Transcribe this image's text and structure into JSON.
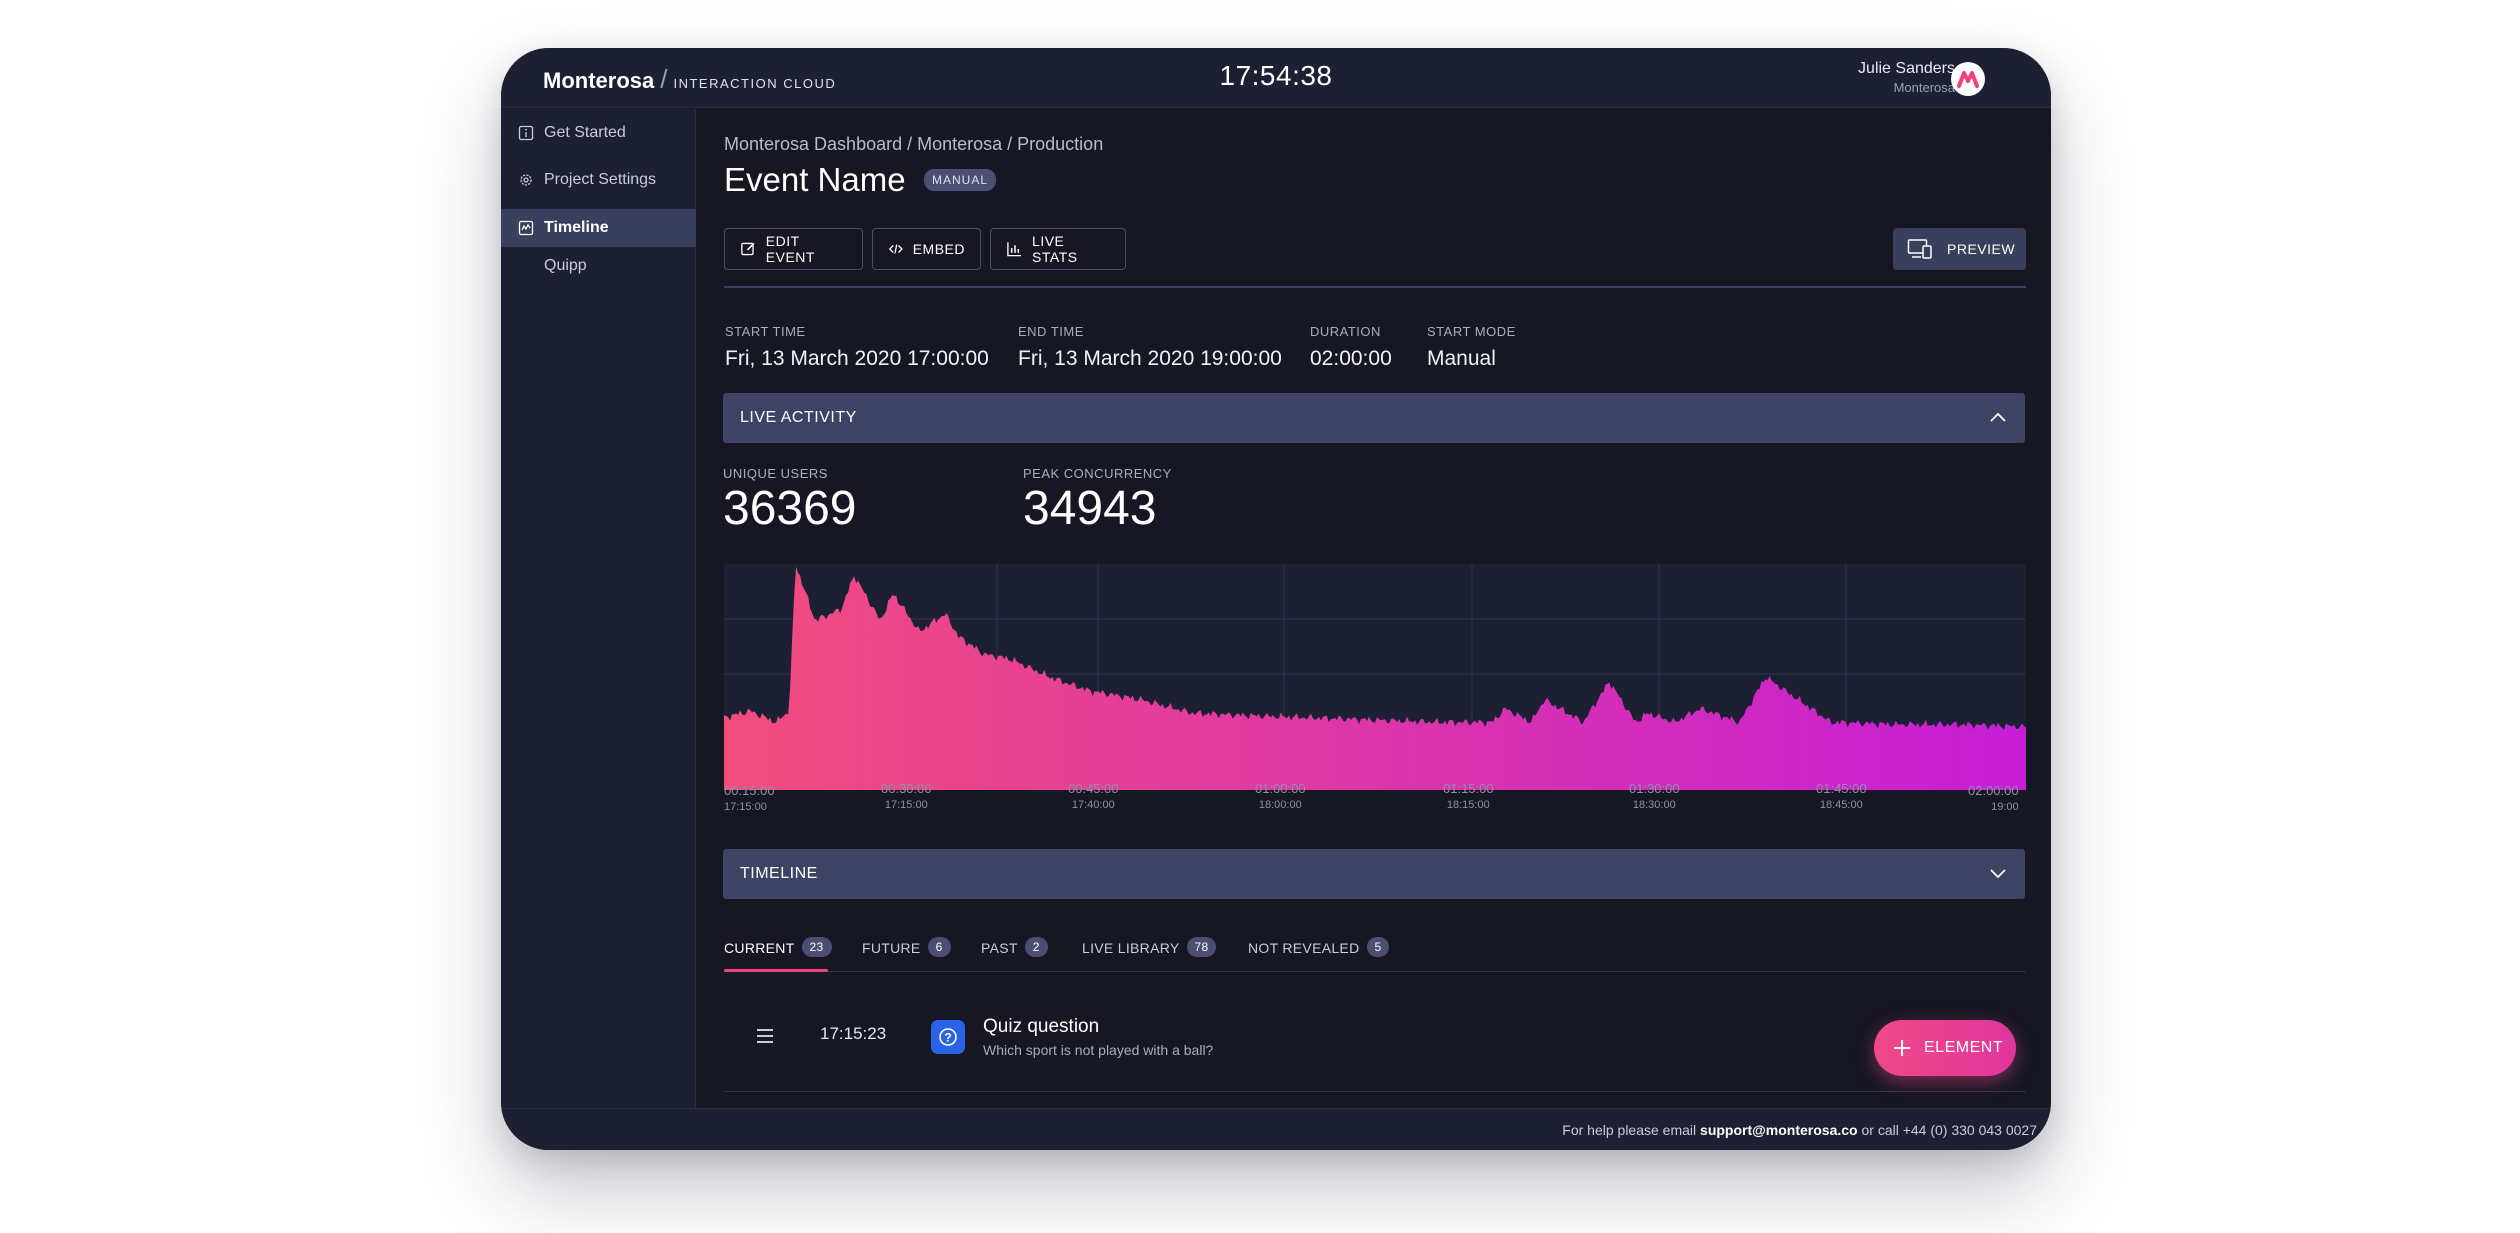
{
  "header": {
    "brand": "Monterosa",
    "brand_sub": "INTERACTION CLOUD",
    "clock": "17:54:38",
    "user_name": "Julie Sanders",
    "user_org": "Monterosa"
  },
  "sidebar": {
    "items": [
      {
        "label": "Get Started",
        "icon": "info-icon"
      },
      {
        "label": "Project Settings",
        "icon": "gear-icon"
      },
      {
        "label": "Timeline",
        "icon": "timeline-icon",
        "active": true
      }
    ],
    "sub_items": [
      "Quipp"
    ]
  },
  "page": {
    "breadcrumb": "Monterosa Dashboard / Monterosa / Production",
    "title": "Event Name",
    "mode_badge": "MANUAL"
  },
  "toolbar": {
    "edit_label": "EDIT EVENT",
    "embed_label": "EMBED",
    "stats_label": "LIVE STATS",
    "preview_label": "PREVIEW"
  },
  "details": {
    "start_time_label": "START TIME",
    "start_time": "Fri, 13 March 2020 17:00:00",
    "end_time_label": "END TIME",
    "end_time": "Fri, 13 March 2020 19:00:00",
    "duration_label": "DURATION",
    "duration": "02:00:00",
    "start_mode_label": "START MODE",
    "start_mode": "Manual"
  },
  "live_activity": {
    "title": "LIVE ACTIVITY",
    "unique_users_label": "UNIQUE USERS",
    "unique_users": "36369",
    "peak_label": "PEAK CONCURRENCY",
    "peak": "34943"
  },
  "chart_data": {
    "type": "area",
    "x_ticks": [
      {
        "elapsed": "00:15:00",
        "clock": "17:15:00"
      },
      {
        "elapsed": "00:30:00",
        "clock": "17:15:00"
      },
      {
        "elapsed": "00:45:00",
        "clock": "17:40:00"
      },
      {
        "elapsed": "01:00:00",
        "clock": "18:00:00"
      },
      {
        "elapsed": "01:15:00",
        "clock": "18:15:00"
      },
      {
        "elapsed": "01:30:00",
        "clock": "18:30:00"
      },
      {
        "elapsed": "01:45:00",
        "clock": "18:45:00"
      },
      {
        "elapsed": "02:00:00",
        "clock": "19:00"
      }
    ],
    "series": [
      {
        "x": [
          0,
          0.02,
          0.04,
          0.05,
          0.055,
          0.07,
          0.09,
          0.1,
          0.12,
          0.13,
          0.15,
          0.17,
          0.18,
          0.2,
          0.22,
          0.25,
          0.28,
          0.32,
          0.36,
          0.4,
          0.45,
          0.5,
          0.55,
          0.59,
          0.6,
          0.62,
          0.63,
          0.66,
          0.68,
          0.7,
          0.71,
          0.73,
          0.75,
          0.78,
          0.8,
          0.85,
          0.9,
          0.95,
          1.0
        ],
        "y": [
          0.32,
          0.35,
          0.3,
          0.35,
          1.0,
          0.75,
          0.8,
          0.95,
          0.75,
          0.87,
          0.7,
          0.78,
          0.68,
          0.6,
          0.58,
          0.5,
          0.44,
          0.4,
          0.34,
          0.33,
          0.32,
          0.31,
          0.3,
          0.3,
          0.36,
          0.3,
          0.4,
          0.3,
          0.48,
          0.3,
          0.34,
          0.3,
          0.36,
          0.3,
          0.5,
          0.3,
          0.29,
          0.29,
          0.28
        ]
      }
    ],
    "colors": [
      "#f24d7d",
      "#c61ed6"
    ],
    "grid": true
  },
  "timeline": {
    "title": "TIMELINE",
    "tabs": [
      {
        "label": "CURRENT",
        "count": "23"
      },
      {
        "label": "FUTURE",
        "count": "6"
      },
      {
        "label": "PAST",
        "count": "2"
      },
      {
        "label": "LIVE LIBRARY",
        "count": "78"
      },
      {
        "label": "NOT REVEALED",
        "count": "5"
      }
    ],
    "rows": [
      {
        "time": "17:15:23",
        "title": "Quiz question",
        "subtitle": "Which sport is not played with a ball?"
      }
    ],
    "add_element_label": "ELEMENT"
  },
  "footer": {
    "help_prefix": "For help please email",
    "email": "support@monterosa.co",
    "phone_text": "or call +44 (0) 330 043 0027"
  }
}
